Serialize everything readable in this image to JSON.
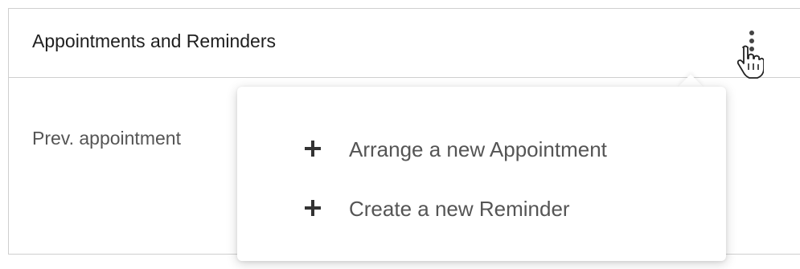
{
  "panel": {
    "title": "Appointments and Reminders",
    "prev_label": "Prev. appointment"
  },
  "menu": {
    "items": [
      {
        "label": "Arrange a new Appointment",
        "icon": "plus-icon"
      },
      {
        "label": "Create a new Reminder",
        "icon": "plus-icon"
      }
    ]
  },
  "icons": {
    "options": "vertical-dots-icon",
    "cursor": "hand-pointer-cursor-icon"
  },
  "colors": {
    "border": "#cfcfcf",
    "title_text": "#1f1f1f",
    "menu_text": "#555555",
    "icon": "#444444"
  }
}
